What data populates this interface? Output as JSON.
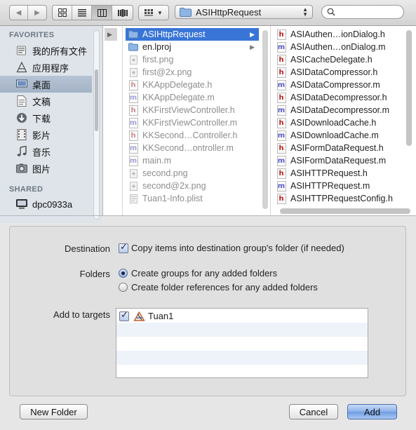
{
  "toolbar": {
    "back_icon": "chevron-left-icon",
    "forward_icon": "chevron-right-icon",
    "view_modes": [
      "icon-view-icon",
      "list-view-icon",
      "column-view-icon",
      "coverflow-view-icon"
    ],
    "active_view": "column-view-icon",
    "arrange_icon": "arrange-grid-icon",
    "path_label": "ASIHttpRequest",
    "search_value": ""
  },
  "sidebar": {
    "favorites_header": "FAVORITES",
    "favorites": [
      {
        "label": "我的所有文件",
        "icon": "all-files-icon"
      },
      {
        "label": "应用程序",
        "icon": "applications-icon"
      },
      {
        "label": "桌面",
        "icon": "desktop-icon",
        "selected": true
      },
      {
        "label": "文稿",
        "icon": "documents-icon"
      },
      {
        "label": "下载",
        "icon": "downloads-icon"
      },
      {
        "label": "影片",
        "icon": "movies-icon"
      },
      {
        "label": "音乐",
        "icon": "music-icon"
      },
      {
        "label": "图片",
        "icon": "pictures-icon"
      }
    ],
    "shared_header": "SHARED",
    "shared": [
      {
        "label": "dpc0933a",
        "icon": "computer-icon"
      }
    ]
  },
  "browser": {
    "column1": [
      {
        "name": "ASIHttpRequest",
        "kind": "folder",
        "selected": true,
        "expandable": true
      },
      {
        "name": "en.lproj",
        "kind": "folder",
        "expandable": true
      },
      {
        "name": "first.png",
        "kind": "image",
        "dim": true
      },
      {
        "name": "first@2x.png",
        "kind": "image",
        "dim": true
      },
      {
        "name": "KKAppDelegate.h",
        "kind": "h",
        "dim": true
      },
      {
        "name": "KKAppDelegate.m",
        "kind": "m",
        "dim": true
      },
      {
        "name": "KKFirstViewController.h",
        "kind": "h",
        "dim": true
      },
      {
        "name": "KKFirstViewController.m",
        "kind": "m",
        "dim": true
      },
      {
        "name": "KKSecond…Controller.h",
        "kind": "h",
        "dim": true
      },
      {
        "name": "KKSecond…ontroller.m",
        "kind": "m",
        "dim": true
      },
      {
        "name": "main.m",
        "kind": "m",
        "dim": true
      },
      {
        "name": "second.png",
        "kind": "image",
        "dim": true
      },
      {
        "name": "second@2x.png",
        "kind": "image",
        "dim": true
      },
      {
        "name": "Tuan1-Info.plist",
        "kind": "plist",
        "dim": true
      }
    ],
    "column2": [
      {
        "name": "ASIAuthen…ionDialog.h",
        "kind": "h"
      },
      {
        "name": "ASIAuthen…onDialog.m",
        "kind": "m"
      },
      {
        "name": "ASICacheDelegate.h",
        "kind": "h"
      },
      {
        "name": "ASIDataCompressor.h",
        "kind": "h"
      },
      {
        "name": "ASIDataCompressor.m",
        "kind": "m"
      },
      {
        "name": "ASIDataDecompressor.h",
        "kind": "h"
      },
      {
        "name": "ASIDataDecompressor.m",
        "kind": "m"
      },
      {
        "name": "ASIDownloadCache.h",
        "kind": "h"
      },
      {
        "name": "ASIDownloadCache.m",
        "kind": "m"
      },
      {
        "name": "ASIFormDataRequest.h",
        "kind": "h"
      },
      {
        "name": "ASIFormDataRequest.m",
        "kind": "m"
      },
      {
        "name": "ASIHTTPRequest.h",
        "kind": "h"
      },
      {
        "name": "ASIHTTPRequest.m",
        "kind": "m"
      },
      {
        "name": "ASIHTTPRequestConfig.h",
        "kind": "h"
      }
    ]
  },
  "options": {
    "destination_label": "Destination",
    "copy_items_label": "Copy items into destination group's folder (if needed)",
    "copy_items_checked": true,
    "folders_label": "Folders",
    "create_groups_label": "Create groups for any added folders",
    "create_refs_label": "Create folder references for any added folders",
    "folders_selected": "groups",
    "targets_label": "Add to targets",
    "targets": [
      {
        "name": "Tuan1",
        "checked": true,
        "icon": "app-target-icon"
      }
    ]
  },
  "buttons": {
    "new_folder": "New Folder",
    "cancel": "Cancel",
    "add": "Add"
  }
}
